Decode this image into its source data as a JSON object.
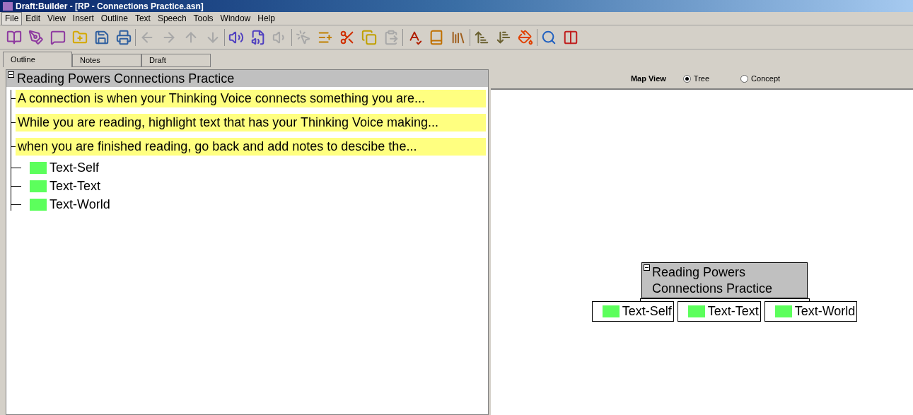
{
  "window": {
    "title": "Draft:Builder - [RP - Connections Practice.asn]"
  },
  "menu": [
    {
      "label": "File",
      "selected": true
    },
    {
      "label": "Edit",
      "selected": false
    },
    {
      "label": "View",
      "selected": false
    },
    {
      "label": "Insert",
      "selected": false
    },
    {
      "label": "Outline",
      "selected": false
    },
    {
      "label": "Text",
      "selected": false
    },
    {
      "label": "Speech",
      "selected": false
    },
    {
      "label": "Tools",
      "selected": false
    },
    {
      "label": "Window",
      "selected": false
    },
    {
      "label": "Help",
      "selected": false
    }
  ],
  "toolbar": [
    [
      {
        "disabled": false
      },
      {
        "disabled": false
      },
      {
        "disabled": false
      },
      {
        "disabled": false
      },
      {
        "disabled": false
      },
      {
        "disabled": false
      }
    ],
    [
      {
        "disabled": true
      },
      {
        "disabled": true
      },
      {
        "disabled": true
      },
      {
        "disabled": true
      }
    ],
    [
      {
        "disabled": false
      },
      {
        "disabled": false
      },
      {
        "disabled": true
      }
    ],
    [
      {
        "disabled": true
      },
      {
        "disabled": false
      },
      {
        "disabled": false
      },
      {
        "disabled": false
      },
      {
        "disabled": true
      }
    ],
    [
      {
        "disabled": false
      },
      {
        "disabled": false
      },
      {
        "disabled": false
      }
    ],
    [
      {
        "disabled": false
      },
      {
        "disabled": false
      },
      {
        "disabled": false
      }
    ],
    [
      {
        "disabled": false
      },
      {
        "disabled": false
      }
    ]
  ],
  "tabs": [
    {
      "label": "Outline",
      "selected": true
    },
    {
      "label": "Notes",
      "selected": false
    },
    {
      "label": "Draft",
      "selected": false
    }
  ],
  "outline": {
    "title": "Reading Powers Connections Practice",
    "expanded": true,
    "children": [
      {
        "kind": "note",
        "text": "A connection is when your Thinking Voice connects something you are..."
      },
      {
        "kind": "note",
        "text": "While you are reading, highlight text that has your Thinking Voice making..."
      },
      {
        "kind": "note",
        "text": "when you are finished reading, go back and add notes to descibe the..."
      },
      {
        "kind": "topic",
        "text": "Text-Self",
        "color": "#5cff5c"
      },
      {
        "kind": "topic",
        "text": "Text-Text",
        "color": "#5cff5c"
      },
      {
        "kind": "topic",
        "text": "Text-World",
        "color": "#5cff5c"
      }
    ]
  },
  "map_view": {
    "label": "Map View",
    "options": [
      {
        "label": "Tree",
        "selected": true
      },
      {
        "label": "Concept",
        "selected": false
      }
    ]
  },
  "map": {
    "title_lines": [
      "Reading Powers",
      "Connections Practice"
    ],
    "expanded": true,
    "children": [
      {
        "text": "Text-Self",
        "color": "#5cff5c"
      },
      {
        "text": "Text-Text",
        "color": "#5cff5c"
      },
      {
        "text": "Text-World",
        "color": "#5cff5c"
      }
    ]
  }
}
